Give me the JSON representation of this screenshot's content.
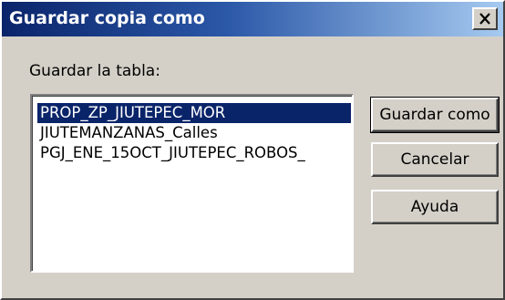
{
  "window": {
    "title": "Guardar copia como",
    "close_icon": "close-icon",
    "close_glyph": "×"
  },
  "form": {
    "prompt": "Guardar la tabla:"
  },
  "tables": {
    "items": [
      {
        "label": "PROP_ZP_JIUTEPEC_MOR",
        "selected": true
      },
      {
        "label": "JIUTEMANZANAS_Calles",
        "selected": false
      },
      {
        "label": "PGJ_ENE_15OCT_JIUTEPEC_ROBOS_",
        "selected": false
      }
    ]
  },
  "buttons": {
    "save_as": "Guardar como",
    "cancel": "Cancelar",
    "help": "Ayuda"
  },
  "colors": {
    "face": "#d4d0c8",
    "selection": "#0a246a",
    "title_start": "#0a246a",
    "title_end": "#a6caf0"
  }
}
